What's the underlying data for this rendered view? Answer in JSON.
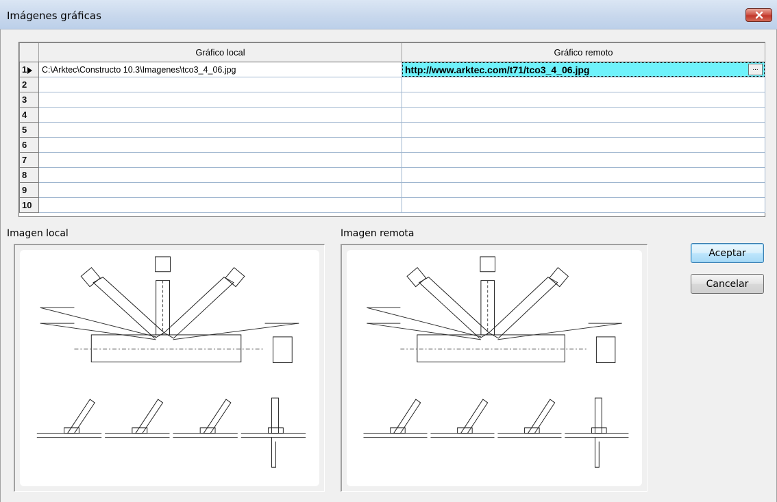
{
  "window": {
    "title": "Imágenes gráficas",
    "close_icon": "close-icon"
  },
  "grid": {
    "columns": [
      "Gráfico local",
      "Gráfico remoto"
    ],
    "rows": [
      {
        "num": "1",
        "local": "C:\\Arktec\\Constructo 10.3\\Imagenes\\tco3_4_06.jpg",
        "remote": "http://www.arktec.com/t71/tco3_4_06.jpg",
        "current": true
      },
      {
        "num": "2",
        "local": "",
        "remote": ""
      },
      {
        "num": "3",
        "local": "",
        "remote": ""
      },
      {
        "num": "4",
        "local": "",
        "remote": ""
      },
      {
        "num": "5",
        "local": "",
        "remote": ""
      },
      {
        "num": "6",
        "local": "",
        "remote": ""
      },
      {
        "num": "7",
        "local": "",
        "remote": ""
      },
      {
        "num": "8",
        "local": "",
        "remote": ""
      },
      {
        "num": "9",
        "local": "",
        "remote": ""
      },
      {
        "num": "10",
        "local": "",
        "remote": ""
      }
    ],
    "ellipsis": "..."
  },
  "panels": {
    "local_label": "Imagen local",
    "remote_label": "Imagen remota"
  },
  "buttons": {
    "accept": "Aceptar",
    "cancel": "Cancelar"
  },
  "colors": {
    "active_cell": "#6ff2fb",
    "close": "#c2372a"
  }
}
